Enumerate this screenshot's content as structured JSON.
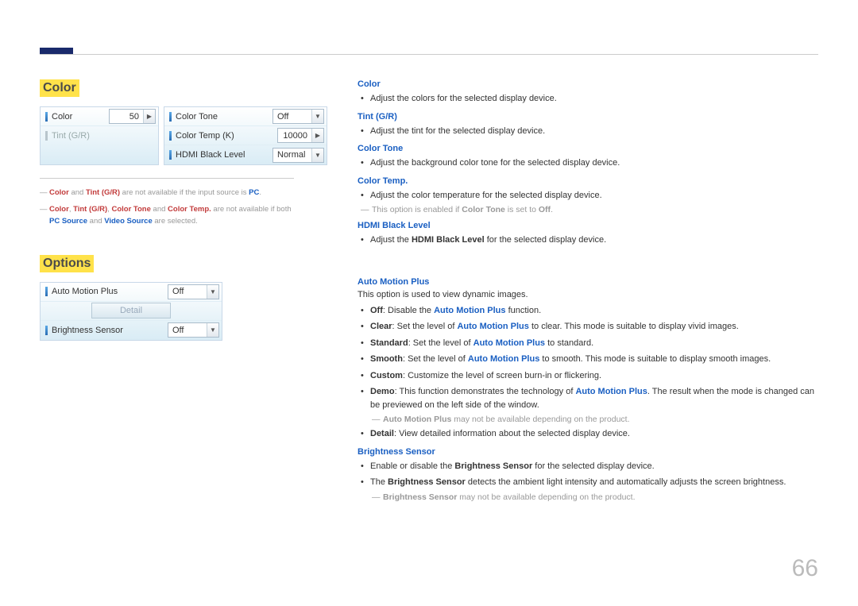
{
  "page_number": "66",
  "sections": {
    "color": {
      "heading": "Color",
      "panel_a": {
        "rows": [
          {
            "label": "Color",
            "value": "50",
            "type": "spin"
          },
          {
            "label": "Tint (G/R)",
            "value": "",
            "type": "disabled"
          }
        ]
      },
      "panel_b": {
        "rows": [
          {
            "label": "Color Tone",
            "value": "Off",
            "type": "combo"
          },
          {
            "label": "Color Temp (K)",
            "value": "10000",
            "type": "spin"
          },
          {
            "label": "HDMI Black Level",
            "value": "Normal",
            "type": "combo"
          }
        ]
      },
      "footnotes": {
        "fn1_pre": "",
        "fn1_color": "Color",
        "fn1_mid": " and ",
        "fn1_tint": "Tint (G/R)",
        "fn1_post": " are not available if the input source is ",
        "fn1_pc": "PC",
        "fn1_end": ".",
        "fn2_a": "Color",
        "fn2_b": "Tint (G/R)",
        "fn2_c": "Color Tone",
        "fn2_d": "Color Temp.",
        "fn2_mid1": ", ",
        "fn2_mid2": " and ",
        "fn2_post": " are not available if both ",
        "fn2_pc": "PC Source",
        "fn2_and": " and ",
        "fn2_vid": "Video Source",
        "fn2_end": " are selected."
      }
    },
    "options": {
      "heading": "Options",
      "panel": {
        "rows": [
          {
            "label": "Auto Motion Plus",
            "value": "Off",
            "type": "combo"
          },
          {
            "label": "Detail",
            "value": "Detail",
            "type": "button"
          },
          {
            "label": "Brightness Sensor",
            "value": "Off",
            "type": "combo"
          }
        ]
      }
    }
  },
  "descriptions": {
    "color": {
      "title": "Color",
      "bullet": "Adjust the colors for the selected display device."
    },
    "tint": {
      "title": "Tint (G/R)",
      "bullet": "Adjust the tint for the selected display device."
    },
    "color_tone": {
      "title": "Color Tone",
      "bullet": "Adjust the background color tone for the selected display device."
    },
    "color_temp": {
      "title": "Color Temp.",
      "bullet": "Adjust the color temperature for the selected display device.",
      "note_pre": "This option is enabled if ",
      "note_bold": "Color Tone",
      "note_mid": " is set to ",
      "note_off": "Off",
      "note_end": "."
    },
    "hdmi": {
      "title": "HDMI Black Level",
      "bullet_pre": "Adjust the ",
      "bullet_bold": "HDMI Black Level",
      "bullet_post": " for the selected display device."
    },
    "amp": {
      "title": "Auto Motion Plus",
      "intro": "This option is used to view dynamic images.",
      "items": {
        "off_b": "Off",
        "off_t": ": Disable the ",
        "off_bold": "Auto Motion Plus",
        "off_end": " function.",
        "clear_b": "Clear",
        "clear_t": ": Set the level of ",
        "clear_bold": "Auto Motion Plus",
        "clear_end": " to clear. This mode is suitable to display vivid images.",
        "std_b": "Standard",
        "std_t": ": Set the level of ",
        "std_bold": "Auto Motion Plus",
        "std_end": " to standard.",
        "smooth_b": "Smooth",
        "smooth_t": ": Set the level of ",
        "smooth_bold": "Auto Motion Plus",
        "smooth_end": " to smooth. This mode is suitable to display smooth images.",
        "custom_b": "Custom",
        "custom_t": ": Customize the level of screen burn-in or flickering.",
        "demo_b": "Demo",
        "demo_t": ": This function demonstrates the technology of ",
        "demo_bold": "Auto Motion Plus",
        "demo_end": ". The result when the mode is changed can be previewed on the left side of the window.",
        "detail_b": "Detail",
        "detail_t": ": View detailed information about the selected display device."
      },
      "note_bold": "Auto Motion Plus",
      "note_text": " may not be available depending on the product."
    },
    "bs": {
      "title": "Brightness Sensor",
      "b1_pre": "Enable or disable the ",
      "b1_bold": "Brightness Sensor",
      "b1_post": " for the selected display device.",
      "b2_pre": "The ",
      "b2_bold": "Brightness Sensor",
      "b2_post": " detects the ambient light intensity and automatically adjusts the screen brightness.",
      "note_bold": "Brightness Sensor",
      "note_text": " may not be available depending on the product."
    }
  }
}
